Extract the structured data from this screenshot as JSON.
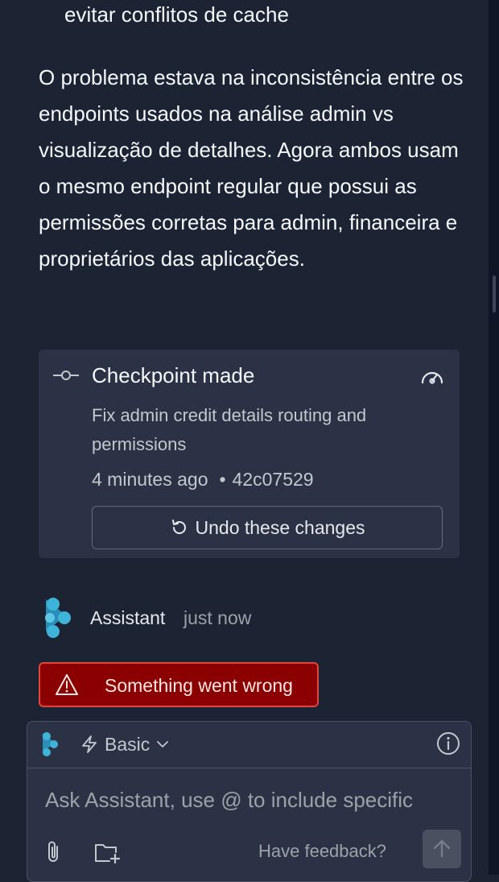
{
  "chat": {
    "bullet_tail": "evitar conflitos de cache",
    "paragraph": "O problema estava na inconsistência entre os endpoints usados na análise admin vs visualização de detalhes. Agora ambos usam o mesmo endpoint regular que possui as permissões corretas para admin, financeira e proprietários das aplicações."
  },
  "checkpoint": {
    "title": "Checkpoint made",
    "message": "Fix admin credit details routing and permissions",
    "time": "4 minutes ago",
    "separator": "•",
    "commit": "42c07529",
    "undo_label": "Undo these changes"
  },
  "assistant": {
    "name": "Assistant",
    "time": "just now"
  },
  "error": {
    "text": "Something went wrong"
  },
  "composer": {
    "mode": "Basic",
    "placeholder": "Ask Assistant, use @ to include specific",
    "feedback": "Have feedback?"
  },
  "colors": {
    "background": "#1c2333",
    "card": "#2b3245",
    "error_bg": "#8b0000",
    "error_border": "#e0463a",
    "logo": "#3fb4d8"
  },
  "icons": {
    "checkpoint": "commit-icon",
    "gauge": "gauge-icon",
    "undo": "undo-icon",
    "warning": "warning-icon",
    "mode": "lightning-icon",
    "chevron": "chevron-down-icon",
    "info": "info-icon",
    "attach": "paperclip-icon",
    "folder": "folder-add-icon",
    "send": "arrow-up-icon"
  }
}
